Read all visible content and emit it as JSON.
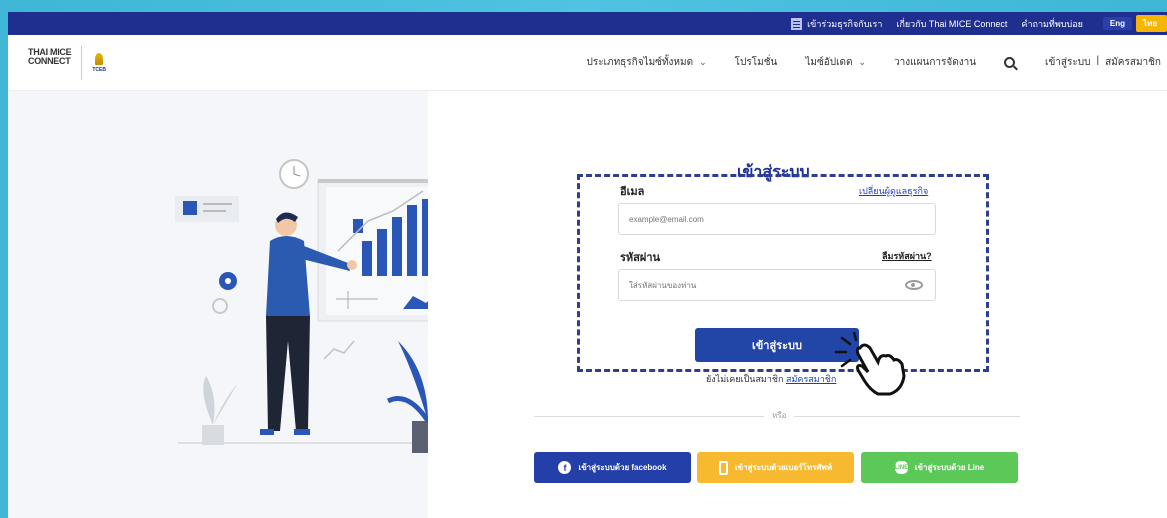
{
  "topbar": {
    "partner_link": "เข้าร่วมธุรกิจกับเรา",
    "about_link": "เกี่ยวกับ Thai MICE Connect",
    "faq_link": "คำถามที่พบบ่อย",
    "lang_eng": "Eng",
    "lang_thai": "ไทย"
  },
  "logo": {
    "line1": "THAI MICE",
    "line2": "CONNECT",
    "tceb": "TCEB"
  },
  "nav": {
    "items": [
      {
        "label": "ประเภทธุรกิจไมซ์ทั้งหมด",
        "has_dropdown": true
      },
      {
        "label": "โปรโมชั่น",
        "has_dropdown": false
      },
      {
        "label": "ไมซ์อัปเดต",
        "has_dropdown": true
      },
      {
        "label": "วางแผนการจัดงาน",
        "has_dropdown": false
      }
    ],
    "login": "เข้าสู่ระบบ",
    "separator": "|",
    "register": "สมัครสมาชิก"
  },
  "login": {
    "title": "เข้าสู่ระบบ",
    "email_label": "อีเมล",
    "switch_link": "เปลี่ยนผู้ดูแลธุรกิจ",
    "email_placeholder": "example@email.com",
    "password_label": "รหัสผ่าน",
    "forgot_link": "ลืมรหัสผ่าน?",
    "password_placeholder": "ใส่รหัสผ่านของท่าน",
    "submit": "เข้าสู่ระบบ",
    "no_account": "ยังไม่เคยเป็นสมาชิก",
    "register_link": "สมัครสมาชิก",
    "or": "หรือ"
  },
  "social": {
    "facebook": "เข้าสู่ระบบด้วย facebook",
    "phone": "เข้าสู่ระบบด้วยเบอร์โทรศัพท์",
    "line": "เข้าสู่ระบบด้วย Line"
  },
  "colors": {
    "brand": "#1f2f8f",
    "button": "#2246a8",
    "facebook": "#243fa8",
    "phone": "#f7b92f",
    "line": "#5cc857",
    "highlight": "#2d3f8f"
  }
}
